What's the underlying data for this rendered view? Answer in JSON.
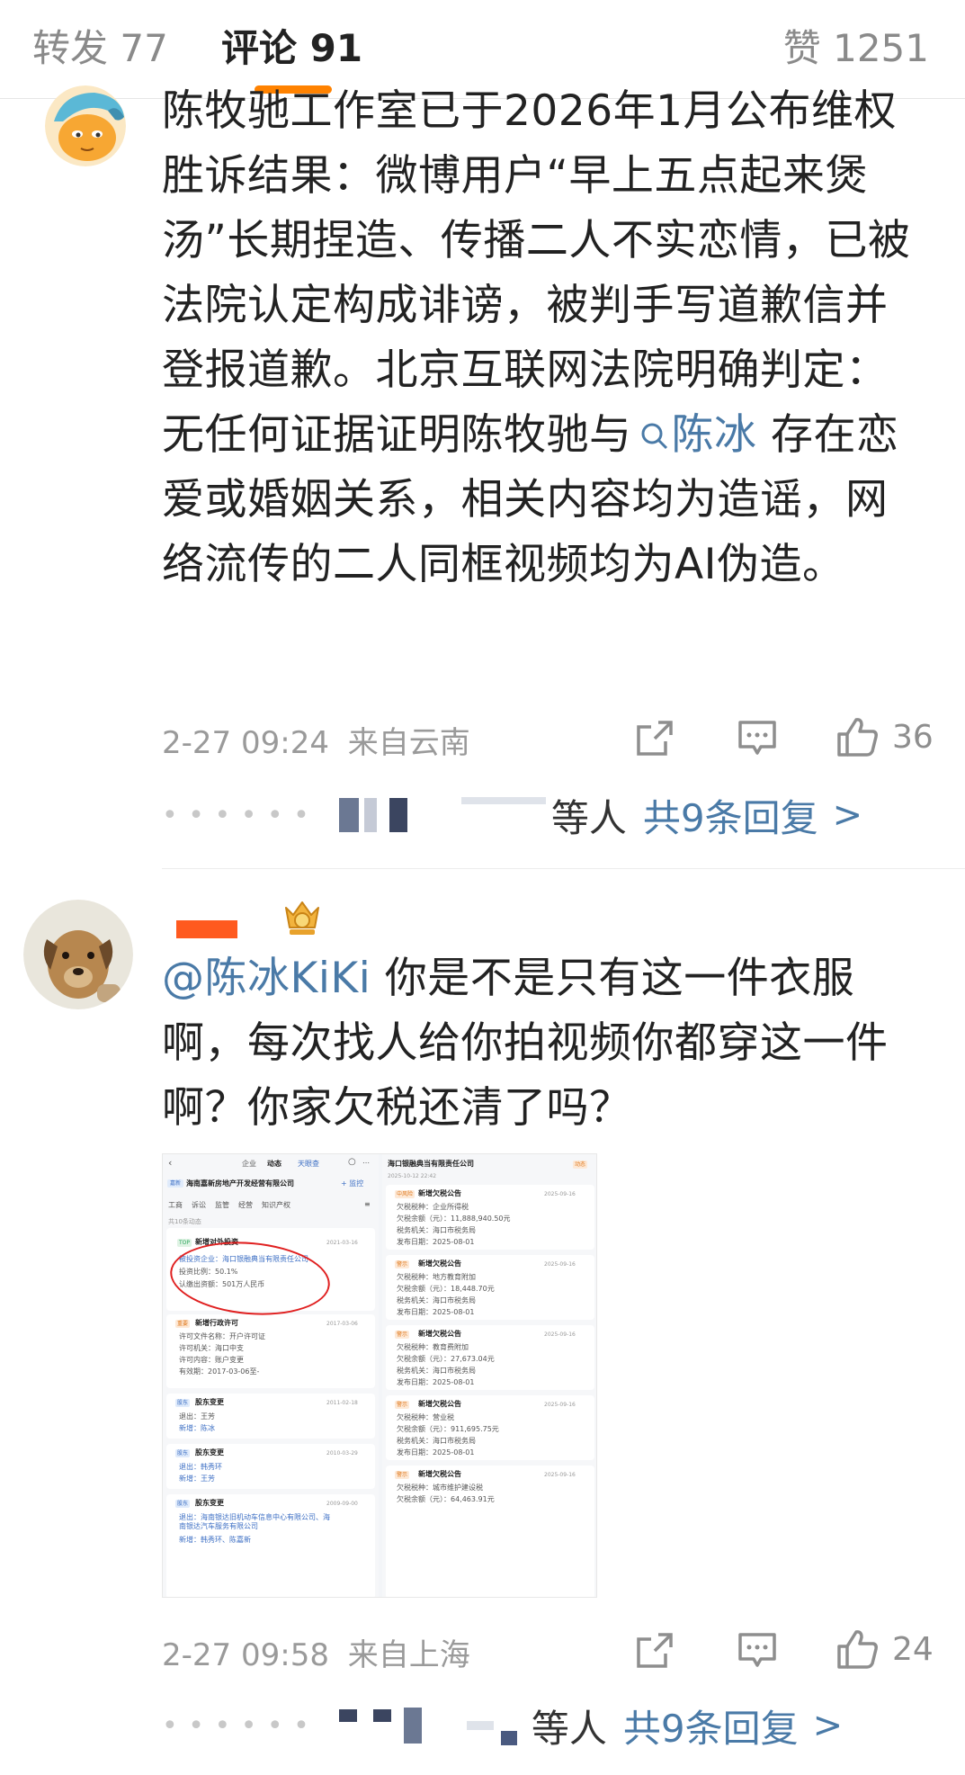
{
  "tabs": {
    "repost": "转发 77",
    "comment": "评论 91",
    "like": "赞 1251",
    "accent": "#ff8200"
  },
  "comments": [
    {
      "text_before": "陈牧驰工作室已于2026年1月公布维权胜诉结果：微博用户“早上五点起来煲汤”长期捏造、传播二人不实恋情，已被法院认定构成诽谤，被判手写道歉信并登报道歉。北京互联网法院明确判定：无任何证据证明陈牧驰与",
      "mention": "陈冰",
      "text_after": " 存在恋爱或婚姻关系，相关内容均为造谣，网络流传的二人同框视频均为AI伪造。",
      "date": "2-27 09:24",
      "location": "来自云南",
      "likes": "36",
      "replies_label": "等人",
      "replies_count": "共9条回复",
      "replies_arrow": ">"
    },
    {
      "mention": "@陈冰KiKi",
      "text_after": " 你是不是只有这一件衣服啊，每次找人给你拍视频你都穿这一件啊？你家欠税还清了吗？",
      "date": "2-27 09:58",
      "location": "来自上海",
      "likes": "24",
      "replies_label": "等人",
      "replies_count": "共9条回复",
      "replies_arrow": ">"
    }
  ],
  "embed": {
    "left": {
      "nav_tabs": [
        "企业",
        "动态"
      ],
      "logo": "天眼查",
      "company": "海南嘉新房地产开发经营有限公司",
      "follow": "+ 监控",
      "subtabs": [
        "工商",
        "诉讼",
        "监管",
        "经营",
        "知识产权"
      ],
      "section": "共10条动态",
      "items": [
        {
          "tag": "TOP",
          "title": "新增对外投资",
          "date": "2021-03-16",
          "rows": [
            "被投资企业：海口银融典当有限责任公司",
            "投资比例：50.1%",
            "认缴出资额：501万人民币"
          ]
        },
        {
          "tag": "重要",
          "title": "新增行政许可",
          "date": "2017-03-06",
          "rows": [
            "许可文件名称：开户许可证",
            "许可机关：海口中支",
            "许可内容：账户变更",
            "有效期：2017-03-06至-"
          ]
        },
        {
          "tag": "股东",
          "title": "股东变更",
          "date": "2011-02-18",
          "rows": [
            "退出：王芳",
            "新增：陈冰"
          ]
        },
        {
          "tag": "股东",
          "title": "股东变更",
          "date": "2010-03-29",
          "rows": [
            "退出：韩秀环",
            "新增：王芳"
          ]
        },
        {
          "tag": "股东",
          "title": "股东变更",
          "date": "2009-09-00",
          "rows": [
            "退出：海南银达旧机动车信息中心有限公司、海南银达汽车服务有限公司",
            "新增：韩秀环、陈嘉新"
          ]
        }
      ]
    },
    "right": {
      "company": "海口银融典当有限责任公司",
      "action": "动态",
      "subtitle": "2025-10-12 22:42",
      "items": [
        {
          "tag": "中风险",
          "title": "新增欠税公告",
          "date": "2025-09-16",
          "rows": [
            "欠税税种：企业所得税",
            "欠税余额（元）：11,888,940.50元",
            "税务机关：海口市税务局",
            "发布日期：2025-08-01"
          ]
        },
        {
          "tag": "警示",
          "title": "新增欠税公告",
          "date": "2025-09-16",
          "rows": [
            "欠税税种：地方教育附加",
            "欠税余额（元）：18,448.70元",
            "税务机关：海口市税务局",
            "发布日期：2025-08-01"
          ]
        },
        {
          "tag": "警示",
          "title": "新增欠税公告",
          "date": "2025-09-16",
          "rows": [
            "欠税税种：教育费附加",
            "欠税余额（元）：27,673.04元",
            "税务机关：海口市税务局",
            "发布日期：2025-08-01"
          ]
        },
        {
          "tag": "警示",
          "title": "新增欠税公告",
          "date": "2025-09-16",
          "rows": [
            "欠税税种：营业税",
            "欠税余额（元）：911,695.75元",
            "税务机关：海口市税务局",
            "发布日期：2025-08-01"
          ]
        },
        {
          "tag": "警示",
          "title": "新增欠税公告",
          "date": "2025-09-16",
          "rows": [
            "欠税税种：城市维护建设税",
            "欠税余额（元）：64,463.91元"
          ]
        }
      ]
    }
  },
  "icons": {
    "share": "share-icon",
    "comment": "comment-icon",
    "like": "thumbs-up-icon",
    "search": "search-icon"
  },
  "colors": {
    "mention": "#4a7aa7",
    "meta": "#9a9a9a",
    "annotation_circle": "#e02020"
  }
}
